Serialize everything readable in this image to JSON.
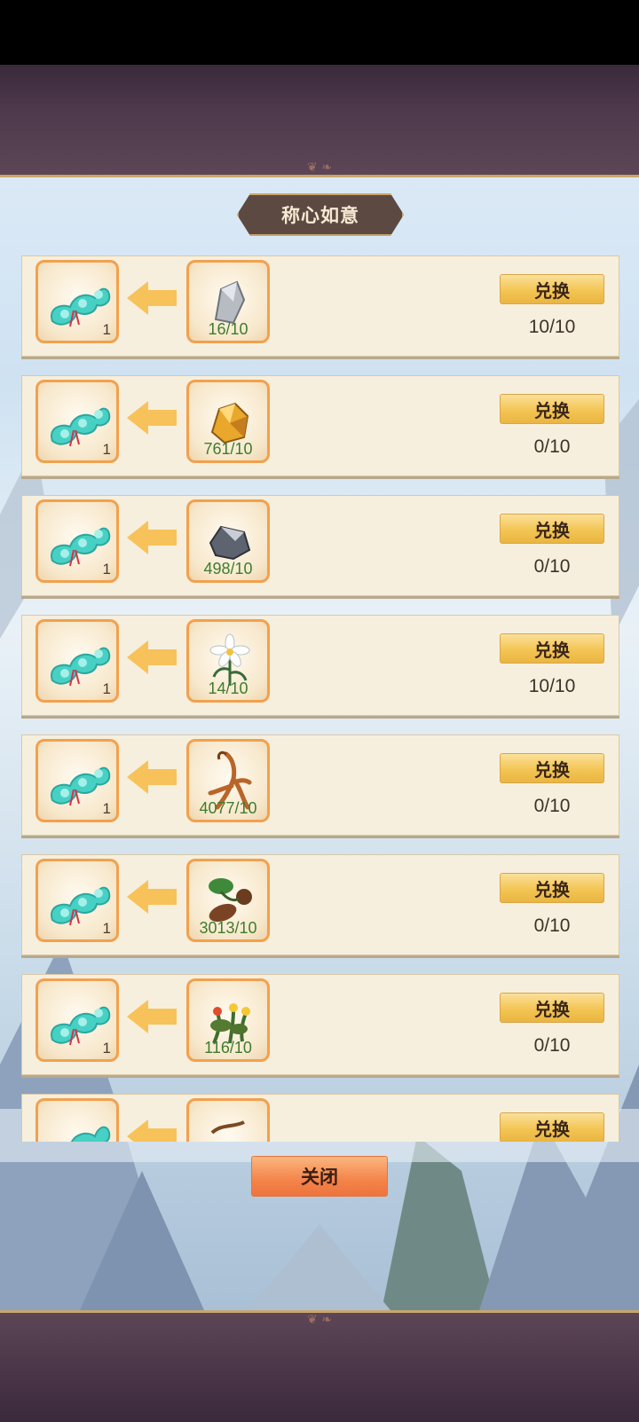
{
  "title": "称心如意",
  "close_label": "关闭",
  "exchange_label": "兑换",
  "rows": [
    {
      "reward_count": "1",
      "cost_icon": "stone-icon",
      "cost_count": "16/10",
      "progress": "10/10"
    },
    {
      "reward_count": "1",
      "cost_icon": "gold-ore-icon",
      "cost_count": "761/10",
      "progress": "0/10"
    },
    {
      "reward_count": "1",
      "cost_icon": "iron-ore-icon",
      "cost_count": "498/10",
      "progress": "0/10"
    },
    {
      "reward_count": "1",
      "cost_icon": "white-flower-icon",
      "cost_count": "14/10",
      "progress": "10/10"
    },
    {
      "reward_count": "1",
      "cost_icon": "ginseng-root-icon",
      "cost_count": "4077/10",
      "progress": "0/10"
    },
    {
      "reward_count": "1",
      "cost_icon": "herb-tuber-icon",
      "cost_count": "3013/10",
      "progress": "0/10"
    },
    {
      "reward_count": "1",
      "cost_icon": "yellow-flower-herb-icon",
      "cost_count": "116/10",
      "progress": "0/10"
    },
    {
      "reward_count": "",
      "cost_icon": "herb-icon",
      "cost_count": "",
      "progress": ""
    }
  ],
  "reward_icon": "ruyi-cloud-scepter-icon",
  "colors": {
    "accent": "#f3c554",
    "close": "#f3844a",
    "count_green": "#3f7c2e",
    "frame": "#4f3a4d"
  }
}
